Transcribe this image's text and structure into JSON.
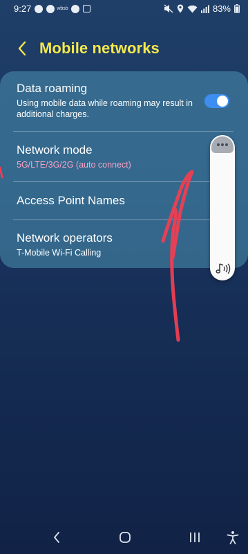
{
  "status_bar": {
    "time": "9:27",
    "left_icon_label": "wbsb",
    "battery": "83%",
    "left_icons": [
      "nosign-icon",
      "clock-badge-icon",
      "nosign-icon",
      "image-icon"
    ],
    "right_icons": [
      "mute-icon",
      "location-icon",
      "wifi-icon",
      "signal-icon",
      "battery-icon"
    ]
  },
  "header": {
    "title": "Mobile networks",
    "back_icon": "chevron-left-icon"
  },
  "settings": {
    "data_roaming": {
      "title": "Data roaming",
      "subtitle": "Using mobile data while roaming may result in additional charges.",
      "toggle_on": true
    },
    "network_mode": {
      "title": "Network mode",
      "value": "5G/LTE/3G/2G (auto connect)"
    },
    "access_point_names": {
      "title": "Access Point Names"
    },
    "network_operators": {
      "title": "Network operators",
      "value": "T-Mobile Wi-Fi Calling"
    }
  },
  "volume_panel": {
    "level": 0.1,
    "icons": [
      "more-options-icon",
      "media-volume-icon"
    ]
  },
  "nav_bar": {
    "icons": [
      "back-icon",
      "home-icon",
      "recents-icon",
      "accessibility-icon"
    ]
  },
  "colors": {
    "title_yellow": "#f5e84c",
    "accent_pink": "#f6a3c4",
    "toggle_blue": "#3d8ef0",
    "annotation_red": "#ee3e53"
  }
}
